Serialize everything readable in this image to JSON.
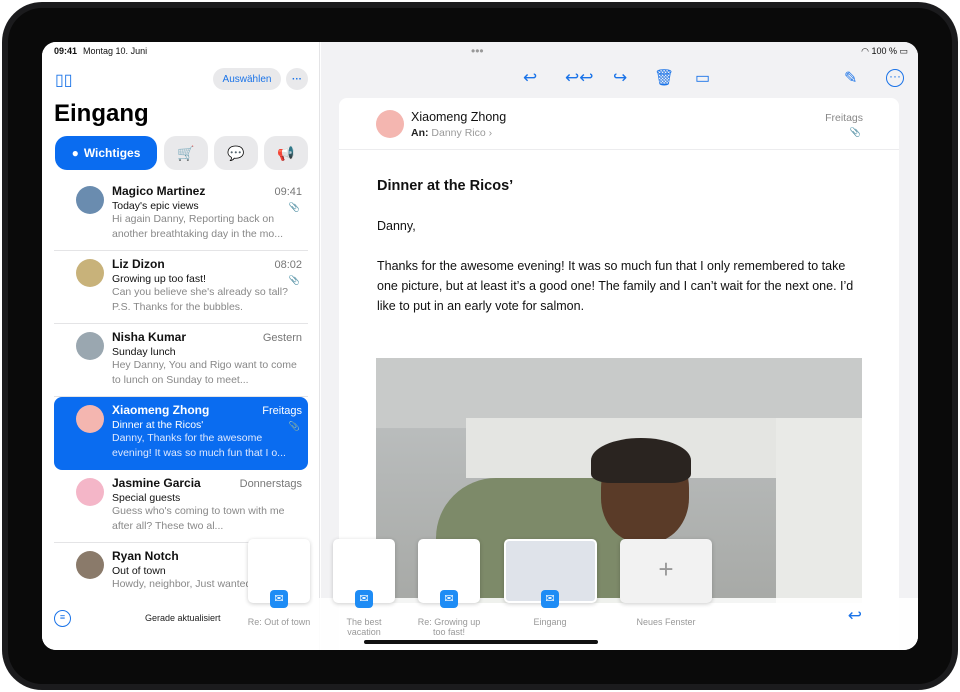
{
  "status": {
    "time": "09:41",
    "date": "Montag 10. Juni",
    "battery": "100 %",
    "wifi_icon": "wifi-icon"
  },
  "sidebar": {
    "select_label": "Auswählen",
    "title": "Eingang",
    "filter_primary": "Wichtiges",
    "updated": "Gerade aktualisiert"
  },
  "messages": [
    {
      "name": "Magico Martinez",
      "date": "09:41",
      "subject": "Today's epic views",
      "preview": "Hi again Danny, Reporting back on another breathtaking day in the mo...",
      "color": "#6a8caf"
    },
    {
      "name": "Liz Dizon",
      "date": "08:02",
      "subject": "Growing up too fast!",
      "preview": "Can you believe she's already so tall? P.S. Thanks for the bubbles.",
      "color": "#c8b27a"
    },
    {
      "name": "Nisha Kumar",
      "date": "Gestern",
      "subject": "Sunday lunch",
      "preview": "Hey Danny, You and Rigo want to come to lunch on Sunday to meet...",
      "color": "#9aa7b0"
    },
    {
      "name": "Xiaomeng Zhong",
      "date": "Freitags",
      "subject": "Dinner at the Ricos'",
      "preview": "Danny, Thanks for the awesome evening! It was so much fun that I o...",
      "color": "#f4b6b0"
    },
    {
      "name": "Jasmine Garcia",
      "date": "Donnerstags",
      "subject": "Special guests",
      "preview": "Guess who's coming to town with me after all? These two al...",
      "color": "#f4b6c8"
    },
    {
      "name": "Ryan Notch",
      "date": "",
      "subject": "Out of town",
      "preview": "Howdy, neighbor, Just wanted...",
      "color": "#8a7a6a"
    }
  ],
  "email": {
    "from": "Xiaomeng Zhong",
    "to_label": "An:",
    "to": "Danny Rico",
    "date": "Freitags",
    "subject": "Dinner at the Ricos’",
    "greeting": "Danny,",
    "body": "Thanks for the awesome evening! It was so much fun that I only remembered to take one picture, but at least it’s a good one! The family and I can’t wait for the next one. I’d like to put in an early vote for salmon."
  },
  "switcher": [
    {
      "label": "Re: Out of town"
    },
    {
      "label": "The best vacation"
    },
    {
      "label": "Re: Growing up too fast!"
    },
    {
      "label": "Eingang"
    },
    {
      "label": "Neues Fenster"
    }
  ],
  "colors": {
    "accent": "#0a6cf0"
  }
}
